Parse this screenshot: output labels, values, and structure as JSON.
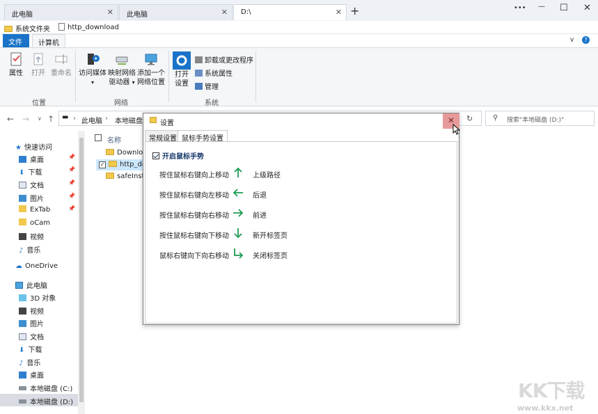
{
  "tabs": [
    {
      "label": "此电脑"
    },
    {
      "label": "此电脑"
    },
    {
      "label": "D:\\"
    }
  ],
  "window_controls": {
    "more": "•••",
    "minimize": "—",
    "maximize": "☐",
    "close": "✕"
  },
  "bookmarks": [
    {
      "label": "系统文件夹"
    },
    {
      "label": "http_download"
    }
  ],
  "ribbon_tabs": {
    "file": "文件",
    "computer": "计算机"
  },
  "ribbon": {
    "location": {
      "properties": "属性",
      "open": "打开",
      "rename": "重命名",
      "group": "位置"
    },
    "network": {
      "access_media": "访问媒体",
      "map_drive_1": "映射网络",
      "map_drive_2": "驱动器",
      "add_location_1": "添加一个",
      "add_location_2": "网络位置",
      "group": "网络"
    },
    "system": {
      "open_settings_1": "打开",
      "open_settings_2": "设置",
      "uninstall": "卸载或更改程序",
      "sys_props": "系统属性",
      "manage": "管理",
      "group": "系统"
    }
  },
  "address": {
    "crumbs": [
      "此电脑",
      "本地磁盘"
    ],
    "search_placeholder": "搜索\"本地磁盘 (D:)\""
  },
  "sidebar": {
    "quick_access": "快速访问",
    "quick_items": [
      "桌面",
      "下载",
      "文档",
      "图片",
      "ExTab",
      "oCam",
      "视频",
      "音乐"
    ],
    "onedrive": "OneDrive",
    "this_pc": "此电脑",
    "pc_items": [
      "3D 对象",
      "视频",
      "图片",
      "文档",
      "下载",
      "音乐",
      "桌面",
      "本地磁盘 (C:)",
      "本地磁盘 (D:)"
    ]
  },
  "filelist": {
    "column_name": "名称",
    "files": [
      "Downloa",
      "http_dov",
      "safeInsta"
    ]
  },
  "dialog": {
    "title": "设置",
    "close": "✕",
    "tabs": [
      "常规设置",
      "鼠标手势设置"
    ],
    "enable_label": "开启鼠标手势",
    "gestures": [
      {
        "desc": "按住鼠标右键向上移动",
        "action": "上级路径",
        "arrow": "up-arrow-icon"
      },
      {
        "desc": "按住鼠标右键向左移动",
        "action": "后退",
        "arrow": "left-arrow-icon"
      },
      {
        "desc": "按住鼠标右键向右移动",
        "action": "前进",
        "arrow": "right-arrow-icon"
      },
      {
        "desc": "按住鼠标右键向下移动",
        "action": "新开标签页",
        "arrow": "down-arrow-icon"
      },
      {
        "desc": "鼠标右键向下向右移动",
        "action": "关闭标签页",
        "arrow": "down-right-arrow-icon"
      }
    ]
  },
  "watermark": {
    "logo": "KK下载",
    "url": "www.kkx.net"
  },
  "colors": {
    "accent": "#1a73c8",
    "arrow_green": "#1b9a54",
    "close_hover": "#e79a9a"
  }
}
